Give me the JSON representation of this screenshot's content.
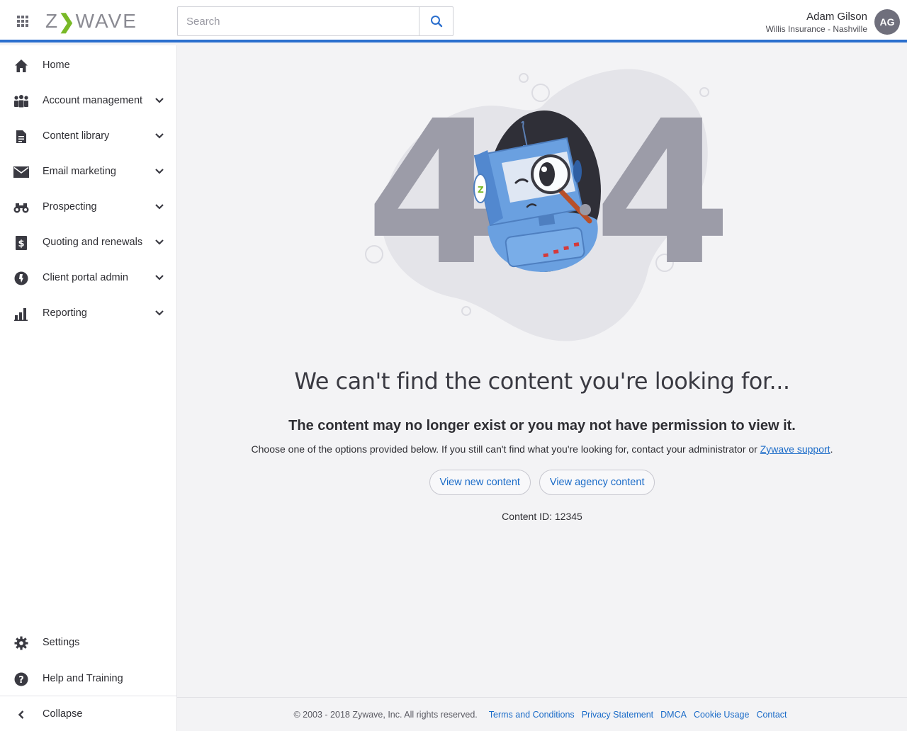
{
  "header": {
    "logo_text_left": "Z",
    "logo_text_right": "WAVE",
    "search_placeholder": "Search",
    "user_name": "Adam Gilson",
    "user_org": "Willis Insurance - Nashville",
    "avatar_initials": "AG"
  },
  "sidebar": {
    "items": [
      {
        "label": "Home",
        "icon": "home-icon",
        "expandable": false
      },
      {
        "label": "Account management",
        "icon": "people-icon",
        "expandable": true
      },
      {
        "label": "Content library",
        "icon": "document-icon",
        "expandable": true
      },
      {
        "label": "Email marketing",
        "icon": "envelope-icon",
        "expandable": true
      },
      {
        "label": "Prospecting",
        "icon": "binoculars-icon",
        "expandable": true
      },
      {
        "label": "Quoting and renewals",
        "icon": "dollar-document-icon",
        "expandable": true
      },
      {
        "label": "Client portal admin",
        "icon": "portal-icon",
        "expandable": true
      },
      {
        "label": "Reporting",
        "icon": "bar-chart-icon",
        "expandable": true
      }
    ],
    "settings_label": "Settings",
    "help_label": "Help and Training",
    "collapse_label": "Collapse"
  },
  "main": {
    "error_code_left": "4",
    "error_code_right": "4",
    "headline": "We can't find the content you're looking for...",
    "subhead": "The content may no longer exist or you may not have permission to view it.",
    "desc_text": "Choose one of the options provided below. If you still can't find what you're looking for, contact your administrator or ",
    "desc_link": "Zywave support",
    "desc_end": ".",
    "button_new": "View new content",
    "button_agency": "View agency content",
    "content_id": "Content ID: 12345"
  },
  "footer": {
    "copyright": "© 2003 - 2018 Zywave, Inc. All rights reserved.",
    "links": [
      "Terms and Conditions",
      "Privacy Statement",
      "DMCA",
      "Cookie Usage",
      "Contact"
    ]
  },
  "colors": {
    "accent": "#2b6fce",
    "link": "#1a6bc8",
    "logo_green": "#79b927",
    "digit_gray": "#9c9ca8"
  }
}
